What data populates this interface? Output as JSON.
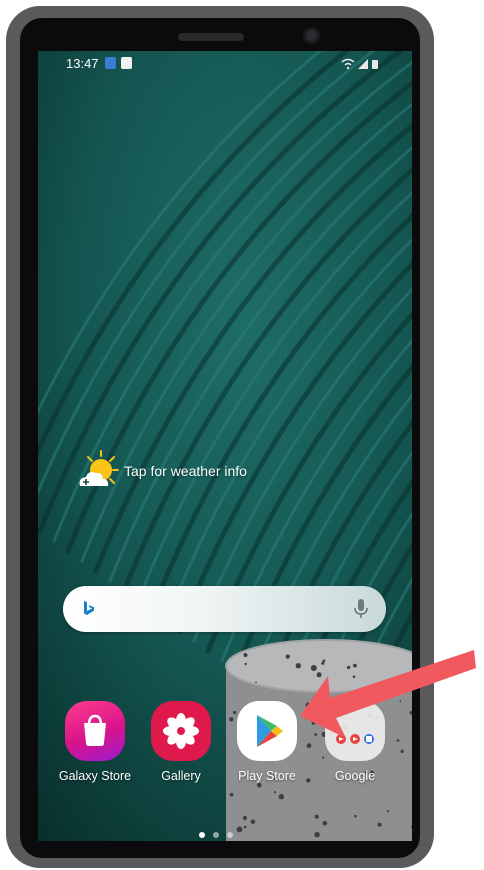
{
  "status_bar": {
    "time": "13:47"
  },
  "weather_widget": {
    "label": "Tap for weather info"
  },
  "search_bar": {
    "placeholder": ""
  },
  "dock": {
    "apps": [
      {
        "label": "Galaxy Store",
        "icon": "galaxy-store-icon"
      },
      {
        "label": "Gallery",
        "icon": "gallery-icon"
      },
      {
        "label": "Play Store",
        "icon": "play-store-icon"
      },
      {
        "label": "Google",
        "icon": "google-folder-icon"
      }
    ]
  },
  "page_indicator": {
    "pages": 3,
    "active": 0
  },
  "colors": {
    "annotation_arrow": "#f05a5f",
    "wallpaper": "#0d3a36",
    "phone_frame": "#5a5a5c"
  }
}
